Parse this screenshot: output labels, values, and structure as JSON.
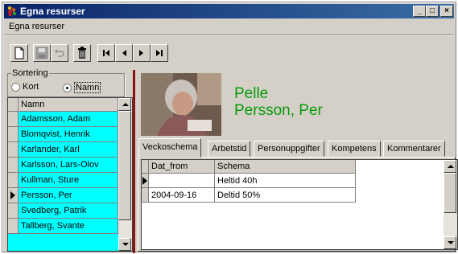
{
  "window": {
    "title": "Egna resurser",
    "minimize_icon": "minimize-icon",
    "maximize_icon": "maximize-icon",
    "close_icon": "close-icon"
  },
  "menu": {
    "items": [
      "Egna resurser"
    ]
  },
  "toolbar": {
    "icons": [
      "new-document-icon",
      "save-icon",
      "undo-icon",
      "delete-trash-icon",
      "first-record-icon",
      "previous-record-icon",
      "next-record-icon",
      "last-record-icon"
    ]
  },
  "sort": {
    "legend": "Sortering",
    "option_kort": "Kort",
    "option_namn": "Namn",
    "selected": "Namn"
  },
  "names_grid": {
    "header": "Namn",
    "rows": [
      "Adamsson, Adam",
      "Blomqvist, Henrik",
      "Karlander, Karl",
      "Karlsson, Lars-Olov",
      "Kullman, Sture",
      "Persson, Per",
      "Svedberg, Patrik",
      "Tallberg, Svante"
    ],
    "current_row": "Persson, Per"
  },
  "person": {
    "first_name": "Pelle",
    "full_name": "Persson, Per"
  },
  "tabs": [
    "Veckoschema",
    "Arbetstid",
    "Personuppgifter",
    "Kompetens",
    "Kommentarer"
  ],
  "active_tab": "Veckoschema",
  "schedule_grid": {
    "columns": [
      "Dat_from",
      "Schema"
    ],
    "rows": [
      {
        "dat_from": "",
        "schema": "Heltid 40h"
      },
      {
        "dat_from": "2004-09-16",
        "schema": "Deltid 50%"
      }
    ]
  },
  "colors": {
    "list_bg": "#00ffff",
    "name_text": "#0a9a0a",
    "splitter": "#8b1414",
    "title_bar": "#0a246a"
  }
}
